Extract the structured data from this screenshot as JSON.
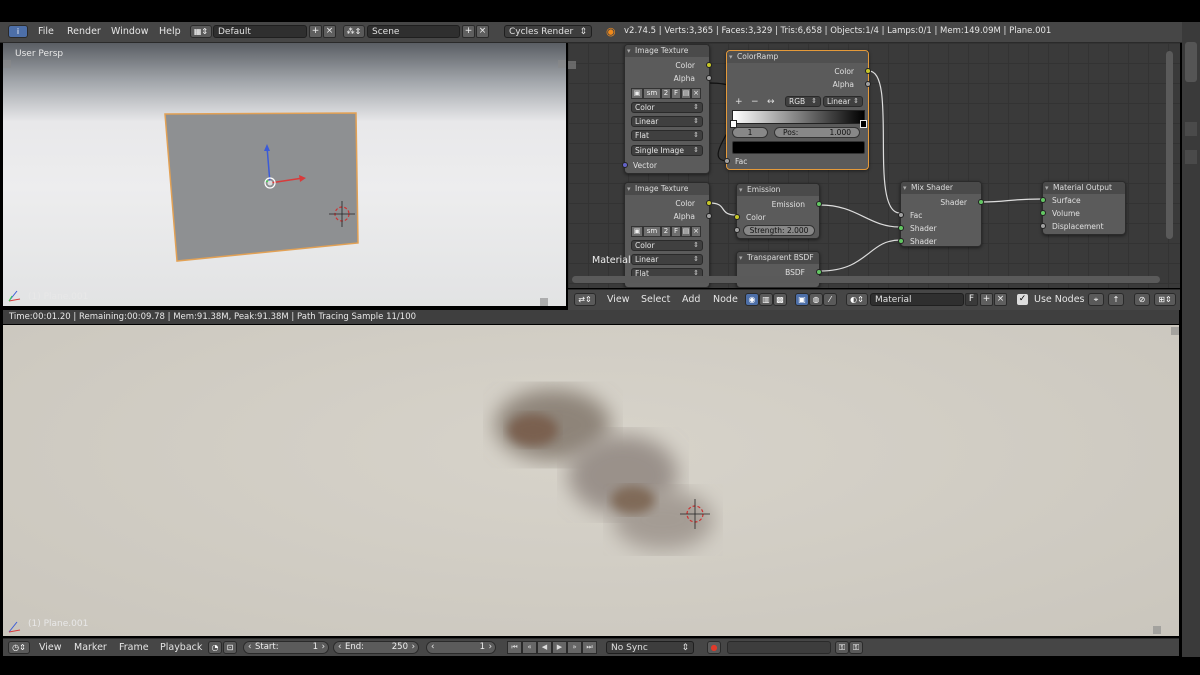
{
  "top_header": {
    "menus": [
      "File",
      "Render",
      "Window",
      "Help"
    ],
    "screen_layout": "Default",
    "scene": "Scene",
    "render_engine": "Cycles Render",
    "stats": "v2.74.5 | Verts:3,365 | Faces:3,329 | Tris:6,658 | Objects:1/4 | Lamps:0/1 | Mem:149.09M | Plane.001"
  },
  "viewport3d": {
    "view_label": "User Persp",
    "object_label": "(1) Plane.001"
  },
  "nodes": {
    "image_texture_1": {
      "title": "Image Texture",
      "out_color": "Color",
      "out_alpha": "Alpha",
      "image_name": "sm",
      "users": "2",
      "fake": "F",
      "color_space": "Color",
      "interpolation": "Linear",
      "projection": "Flat",
      "source": "Single Image",
      "in_vector": "Vector"
    },
    "color_ramp": {
      "title": "ColorRamp",
      "out_color": "Color",
      "out_alpha": "Alpha",
      "add": "+",
      "remove": "−",
      "flip": "↔",
      "color_mode": "RGB",
      "interpolation": "Linear",
      "active_index": "1",
      "pos_label": "Pos:",
      "pos_value": "1.000",
      "in_fac": "Fac"
    },
    "image_texture_2": {
      "title": "Image Texture",
      "out_color": "Color",
      "out_alpha": "Alpha",
      "image_name": "sm",
      "users": "2",
      "fake": "F",
      "color_space": "Color",
      "interpolation": "Linear",
      "projection": "Flat"
    },
    "emission": {
      "title": "Emission",
      "out_emission": "Emission",
      "in_color": "Color",
      "strength_label": "Strength:",
      "strength_value": "2.000"
    },
    "transparent_bsdf": {
      "title": "Transparent BSDF",
      "out_bsdf": "BSDF"
    },
    "mix_shader": {
      "title": "Mix Shader",
      "out_shader": "Shader",
      "in_fac": "Fac",
      "in_shader1": "Shader",
      "in_shader2": "Shader"
    },
    "material_output": {
      "title": "Material Output",
      "in_surface": "Surface",
      "in_volume": "Volume",
      "in_displacement": "Displacement"
    },
    "tree_label": "Material"
  },
  "node_header": {
    "menus": [
      "View",
      "Select",
      "Add",
      "Node"
    ],
    "material": "Material",
    "fake_user": "F",
    "use_nodes_label": "Use Nodes"
  },
  "render": {
    "info": "Time:00:01.20 | Remaining:00:09.78 | Mem:91.38M, Peak:91.38M | Path Tracing Sample 11/100",
    "object_label": "(1) Plane.001"
  },
  "timeline": {
    "menus": [
      "View",
      "Marker",
      "Frame",
      "Playback"
    ],
    "start_label": "Start:",
    "start_value": "1",
    "end_label": "End:",
    "end_value": "250",
    "current_frame": "1",
    "sync": "No Sync"
  },
  "colors": {
    "header_bg": "#464646",
    "node_bg": "#5b5b5b",
    "selected_outline": "#e59a3a",
    "socket_color": "#c7c729",
    "socket_shader": "#63c763",
    "socket_float": "#a1a1a1",
    "socket_vector": "#6363c7"
  }
}
